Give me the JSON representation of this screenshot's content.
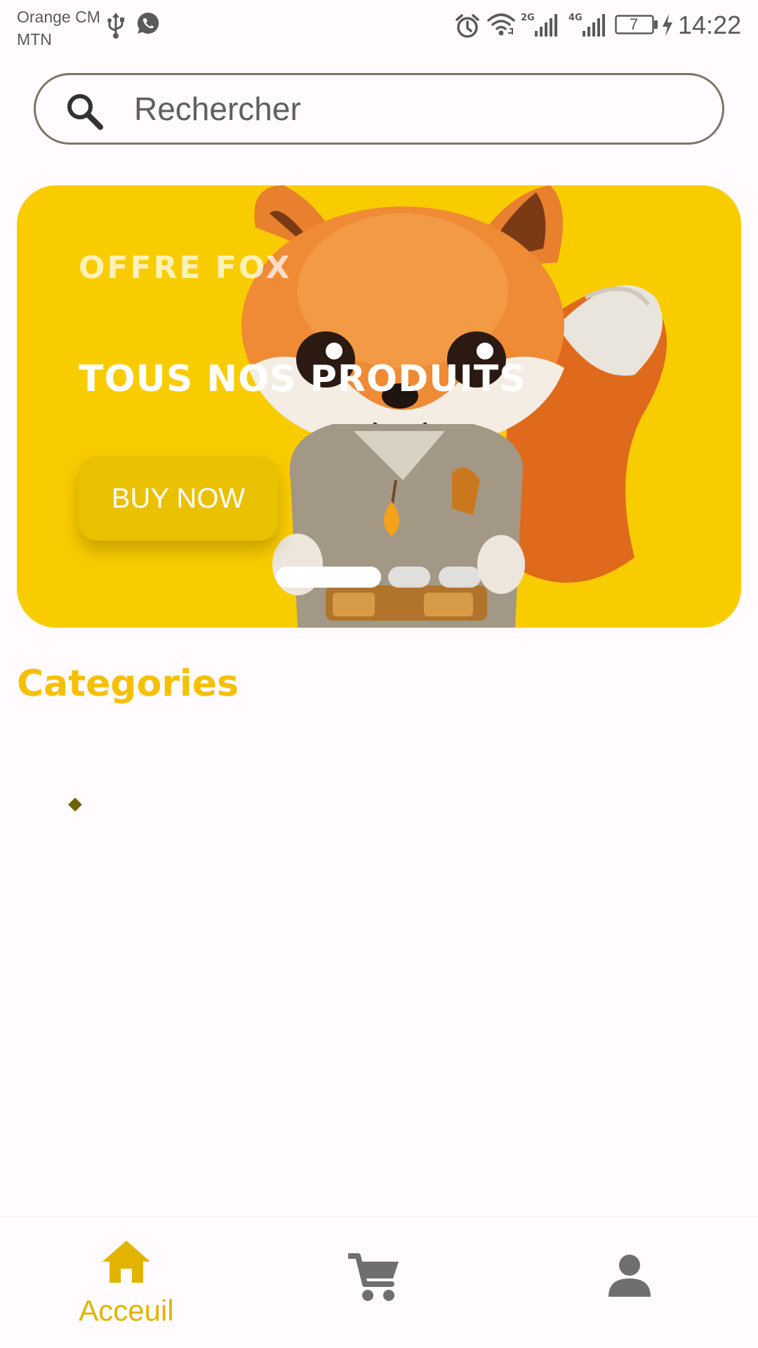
{
  "status_bar": {
    "carrier_line1": "Orange CM",
    "carrier_line2": "MTN",
    "icons": [
      "usb-icon",
      "whatsapp-icon",
      "alarm-icon",
      "wifi-icon",
      "signal-2g-icon",
      "signal-4g-icon",
      "battery-icon",
      "charging-icon"
    ],
    "network_2g": "2G",
    "network_4g": "4G",
    "battery": "7",
    "time": "14:22"
  },
  "search": {
    "placeholder": "Rechercher",
    "value": ""
  },
  "banner": {
    "eyebrow": "OFFRE FOX",
    "title": "TOUS NOS PRODUITS",
    "button_label": "BUY NOW",
    "background_color": "#F9CC00",
    "slide_count": 3,
    "active_slide": 1
  },
  "categories": {
    "title": "Categories",
    "title_color": "#F5C000"
  },
  "bottom_nav": {
    "active_color": "#E2B400",
    "inactive_color": "#6f6f6f",
    "items": [
      {
        "icon": "home-icon",
        "label": "Acceuil",
        "active": true
      },
      {
        "icon": "cart-icon",
        "label": "",
        "active": false
      },
      {
        "icon": "profile-icon",
        "label": "",
        "active": false
      }
    ]
  }
}
